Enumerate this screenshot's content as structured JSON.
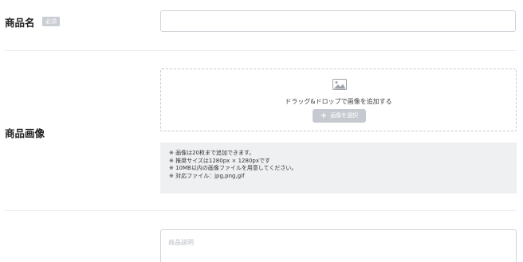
{
  "product_name": {
    "label": "商品名",
    "required_badge": "必須",
    "value": ""
  },
  "product_image": {
    "label": "商品画像",
    "icon": "image-icon",
    "dropzone_text": "ドラッグ&ドロップで画像を追加する",
    "select_button_label": "画像を選択",
    "notes": [
      "※ 画像は20枚まで追加できます。",
      "※ 推奨サイズは1280px × 1280pxです",
      "※ 10MB以内の画像ファイルを用意してください。",
      "※ 対応ファイル：jpg,png,gif"
    ]
  },
  "product_description": {
    "placeholder": "商品説明"
  },
  "colors": {
    "badge_bg": "#c9cdd4",
    "button_bg": "#c6cad0",
    "notes_bg": "#eef0f2",
    "border": "#cfd3d8"
  }
}
